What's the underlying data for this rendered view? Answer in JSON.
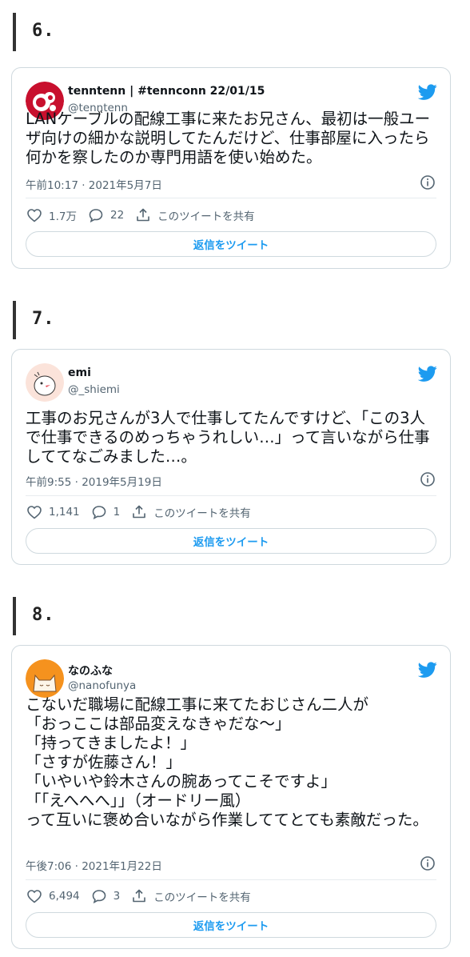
{
  "colors": {
    "accent": "#1d9bf0",
    "muted": "#536471",
    "border": "#cfd9de",
    "heading_bar": "#333333"
  },
  "sections": [
    {
      "number": "6.",
      "author": {
        "name": "tenntenn | #tennconn 22/01/15",
        "handle": "@tenntenn",
        "avatar_icon": "tenntenn-avatar"
      },
      "text": "LANケーブルの配線工事に来たお兄さん、最初は一般ユーザ向けの細かな説明してたんだけど、仕事部屋に入ったら何かを察したのか専門用語を使い始めた。",
      "time": "午前10:17 · 2021年5月7日",
      "likes": "1.7万",
      "replies": "22",
      "share_label": "このツイートを共有",
      "reply_button": "返信をツイート"
    },
    {
      "number": "7.",
      "author": {
        "name": "emi",
        "handle": "@_shiemi",
        "avatar_icon": "bird-drawing-avatar"
      },
      "text": "工事のお兄さんが3人で仕事してたんですけど、「この3人で仕事できるのめっちゃうれしい…」って言いながら仕事しててなごみました…。",
      "time": "午前9:55 · 2019年5月19日",
      "likes": "1,141",
      "replies": "1",
      "share_label": "このツイートを共有",
      "reply_button": "返信をツイート"
    },
    {
      "number": "8.",
      "author": {
        "name": "なのふな",
        "handle": "@nanofunya",
        "avatar_icon": "cat-avatar"
      },
      "text": "こないだ職場に配線工事に来てたおじさん二人が\n「おっここは部品変えなきゃだな～」\n「持ってきましたよ！」\n「さすが佐藤さん！」\n「いやいや鈴木さんの腕あってこそですよ」\n「「えへへへ」」（オードリー風）\nって互いに褒め合いながら作業しててとても素敵だった。",
      "time": "午後7:06 · 2021年1月22日",
      "likes": "6,494",
      "replies": "3",
      "share_label": "このツイートを共有",
      "reply_button": "返信をツイート"
    }
  ]
}
